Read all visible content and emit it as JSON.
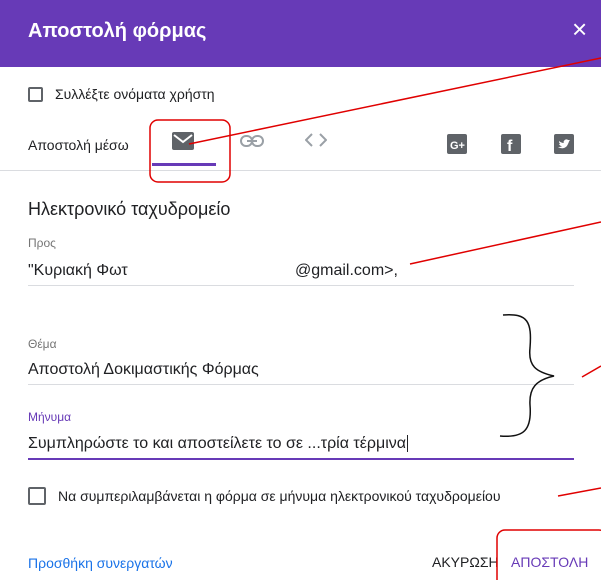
{
  "dialog": {
    "title": "Αποστολή φόρμας",
    "close_glyph": "×"
  },
  "collect": {
    "label": "Συλλέξτε ονόματα χρήστη",
    "checked": false
  },
  "send_via": {
    "label": "Αποστολή μέσω",
    "icons": [
      "email-icon",
      "link-icon",
      "embed-code-icon",
      "google-plus-icon",
      "facebook-icon",
      "twitter-icon"
    ],
    "selected": "email-icon"
  },
  "email": {
    "section_title": "Ηλεκτρονικό ταχυδρομείο",
    "to_label": "Προς",
    "to_value_start": "\"Κυριακή Φωτ",
    "to_value_end": "@gmail.com>,",
    "subject_label": "Θέμα",
    "subject_value": "Αποστολή Δοκιμαστικής Φόρμας",
    "message_label": "Μήνυμα",
    "message_value": "Συμπληρώστε το και αποστείλετε το σε ...τρία τέρμινα"
  },
  "include": {
    "label": "Να συμπεριλαμβάνεται η φόρμα σε μήνυμα ηλεκτρονικού ταχυδρομείου",
    "checked": false
  },
  "footer": {
    "add_collaborators": "Προσθήκη συνεργατών",
    "cancel": "ΑΚΥΡΩΣΗ",
    "send": "ΑΠΟΣΤΟΛΗ"
  },
  "colors": {
    "header": "#673ab7",
    "accent": "#673ab7",
    "link": "#1a73e8",
    "annotation": "#e00000"
  }
}
